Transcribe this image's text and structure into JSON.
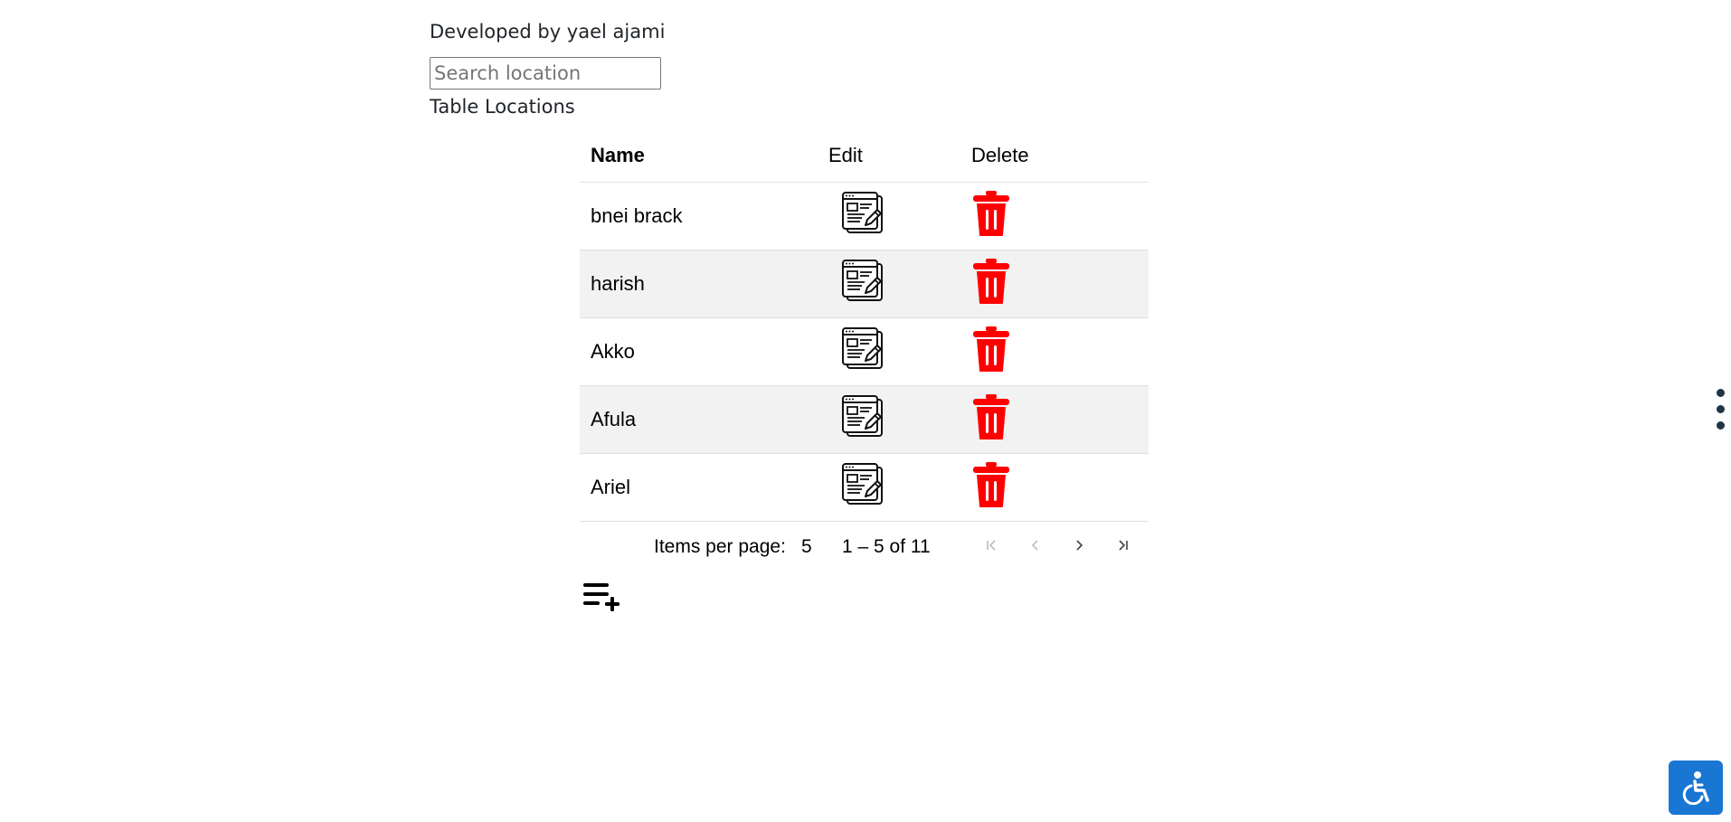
{
  "header": {
    "credit": "Developed by yael ajami"
  },
  "search": {
    "placeholder": "Search location",
    "value": ""
  },
  "table": {
    "caption": "Table Locations",
    "columns": [
      "Name",
      "Edit",
      "Delete"
    ],
    "rows": [
      {
        "name": "bnei brack"
      },
      {
        "name": "harish"
      },
      {
        "name": "Akko"
      },
      {
        "name": "Afula"
      },
      {
        "name": "Ariel"
      }
    ]
  },
  "paginator": {
    "items_per_page_label": "Items per page:",
    "items_per_page_value": "5",
    "range_label": "1 – 5 of 11",
    "first_icon": "first-page-icon",
    "prev_icon": "chevron-left-icon",
    "next_icon": "chevron-right-icon",
    "last_icon": "last-page-icon"
  },
  "icons": {
    "edit": "edit-document-icon",
    "delete": "trash-icon",
    "add": "playlist-add-icon",
    "side_menu": "more-vertical-icon",
    "accessibility": "accessibility-icon"
  },
  "colors": {
    "delete_red": "#ff0000",
    "row_alt_bg": "#f2f2f2",
    "accessibility_bg": "#1976d2",
    "side_menu_dots": "#1f3544"
  }
}
